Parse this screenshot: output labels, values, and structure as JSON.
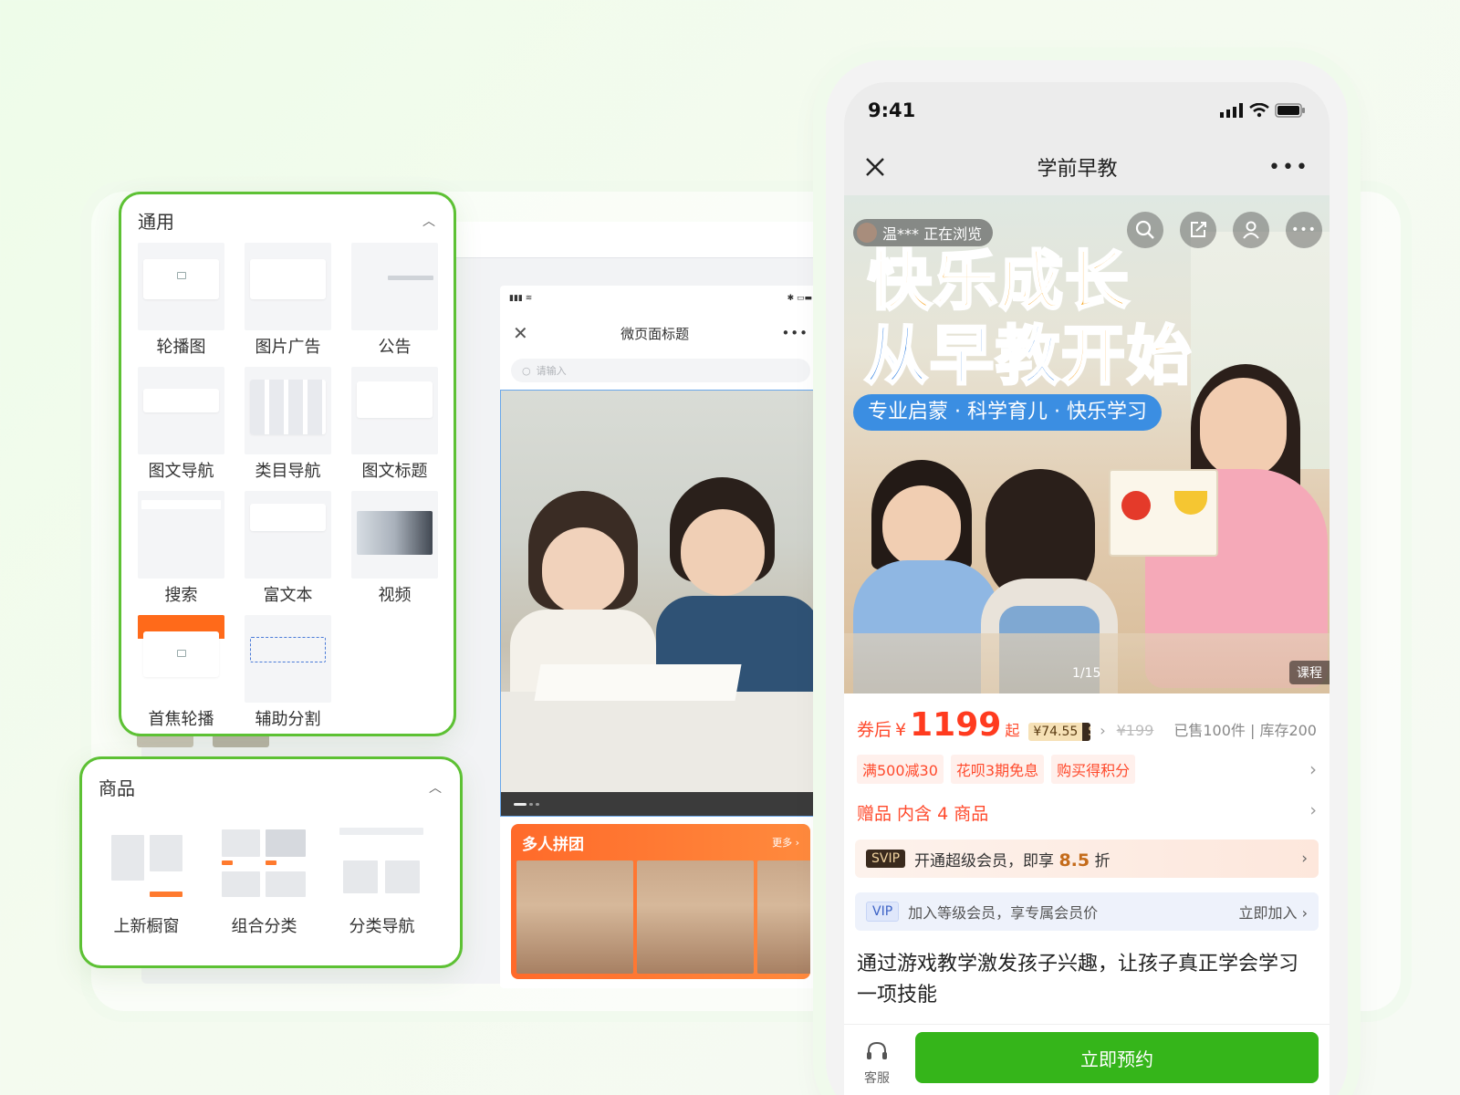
{
  "left_panels": {
    "general": {
      "title": "通用",
      "items": [
        {
          "label": "轮播图",
          "icon": "carousel-thumb"
        },
        {
          "label": "图片广告",
          "icon": "image-ad-thumb"
        },
        {
          "label": "公告",
          "icon": "notice-thumb"
        },
        {
          "label": "图文导航",
          "icon": "image-nav-thumb"
        },
        {
          "label": "类目导航",
          "icon": "category-nav-thumb"
        },
        {
          "label": "图文标题",
          "icon": "image-title-thumb"
        },
        {
          "label": "搜索",
          "icon": "search-thumb"
        },
        {
          "label": "富文本",
          "icon": "rich-text-thumb"
        },
        {
          "label": "视频",
          "icon": "video-thumb"
        },
        {
          "label": "首焦轮播",
          "icon": "focus-carousel-thumb"
        },
        {
          "label": "辅助分割",
          "icon": "divider-thumb"
        }
      ]
    },
    "goods": {
      "title": "商品",
      "items": [
        {
          "label": "上新橱窗",
          "icon": "new-window-thumb"
        },
        {
          "label": "组合分类",
          "icon": "combo-category-thumb"
        },
        {
          "label": "分类导航",
          "icon": "category-nav-thumb"
        }
      ]
    }
  },
  "preview": {
    "page_title": "微页面标题",
    "search_placeholder": "请输入",
    "group_title": "多人拼团",
    "group_more": "更多"
  },
  "phone": {
    "time": "9:41",
    "title": "学前早教",
    "hero": {
      "line1": "快乐成长",
      "line2a": "从早教",
      "line2b": "开始",
      "ribbon": "专业启蒙 · 科学育儿 · 快乐学习",
      "browsing": "温*** 正在浏览",
      "page": "1/15",
      "tag": "课程"
    },
    "price": {
      "prefix": "券后",
      "currency": "¥",
      "amount": "1199",
      "suffix": "起",
      "svip_price": "¥74.55",
      "svip_label": "SVIP",
      "original": "¥199",
      "sold": "已售100件 | 库存200"
    },
    "promos": [
      "满500减30",
      "花呗3期免息",
      "购买得积分"
    ],
    "gift": "赠品 内含 4 商品",
    "svip_row": {
      "badge": "SVIP",
      "text": "开通超级会员，即享",
      "discount": "8.5",
      "unit": "折"
    },
    "vip_row": {
      "badge": "VIP",
      "text": "加入等级会员，享专属会员价",
      "action": "立即加入"
    },
    "description": "通过游戏教学激发孩子兴趣，让孩子真正学会学习一项技能",
    "service": "客服",
    "cta": "立即预约"
  }
}
